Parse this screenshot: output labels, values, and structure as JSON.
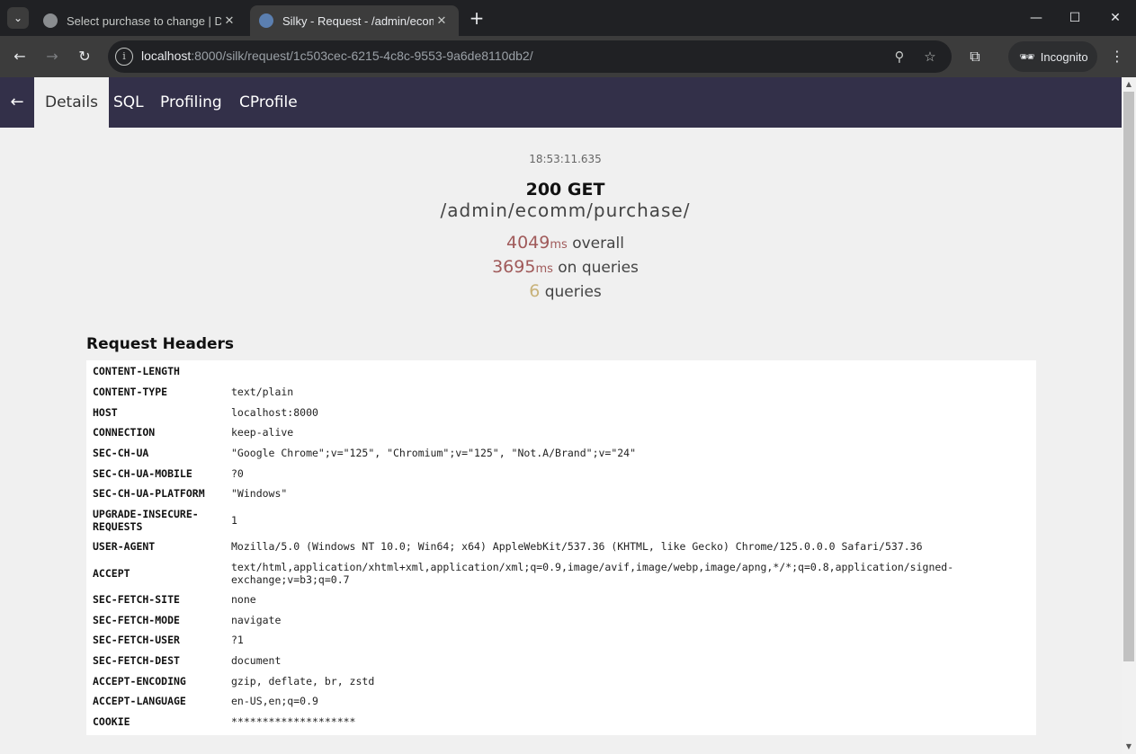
{
  "browser": {
    "tabs": [
      {
        "title": "Select purchase to change | Dja",
        "active": false
      },
      {
        "title": "Silky - Request - /admin/ecomm",
        "active": true
      }
    ],
    "url_host": "localhost",
    "url_rest": ":8000/silk/request/1c503cec-6215-4c8c-9553-9a6de8110db2/",
    "incognito_label": "Incognito"
  },
  "silk_nav": {
    "tabs": [
      {
        "label": "Details",
        "active": true
      },
      {
        "label": "SQL",
        "active": false
      },
      {
        "label": "Profiling",
        "active": false
      },
      {
        "label": "CProfile",
        "active": false
      }
    ]
  },
  "summary": {
    "time": "18:53:11.635",
    "status": "200 GET",
    "path": "/admin/ecomm/purchase/",
    "overall_ms": "4049",
    "overall_unit": "ms",
    "overall_label": "overall",
    "queries_ms": "3695",
    "queries_unit": "ms",
    "queries_ms_label": "on queries",
    "num_queries": "6",
    "num_queries_label": "queries"
  },
  "request_headers": {
    "title": "Request Headers",
    "rows": [
      {
        "key": "CONTENT-LENGTH",
        "value": ""
      },
      {
        "key": "CONTENT-TYPE",
        "value": "text/plain"
      },
      {
        "key": "HOST",
        "value": "localhost:8000"
      },
      {
        "key": "CONNECTION",
        "value": "keep-alive"
      },
      {
        "key": "SEC-CH-UA",
        "value": "\"Google Chrome\";v=\"125\", \"Chromium\";v=\"125\", \"Not.A/Brand\";v=\"24\""
      },
      {
        "key": "SEC-CH-UA-MOBILE",
        "value": "?0"
      },
      {
        "key": "SEC-CH-UA-PLATFORM",
        "value": "\"Windows\""
      },
      {
        "key": "UPGRADE-INSECURE-REQUESTS",
        "value": "1"
      },
      {
        "key": "USER-AGENT",
        "value": "Mozilla/5.0 (Windows NT 10.0; Win64; x64) AppleWebKit/537.36 (KHTML, like Gecko) Chrome/125.0.0.0 Safari/537.36"
      },
      {
        "key": "ACCEPT",
        "value": "text/html,application/xhtml+xml,application/xml;q=0.9,image/avif,image/webp,image/apng,*/*;q=0.8,application/signed-exchange;v=b3;q=0.7"
      },
      {
        "key": "SEC-FETCH-SITE",
        "value": "none"
      },
      {
        "key": "SEC-FETCH-MODE",
        "value": "navigate"
      },
      {
        "key": "SEC-FETCH-USER",
        "value": "?1"
      },
      {
        "key": "SEC-FETCH-DEST",
        "value": "document"
      },
      {
        "key": "ACCEPT-ENCODING",
        "value": "gzip, deflate, br, zstd"
      },
      {
        "key": "ACCEPT-LANGUAGE",
        "value": "en-US,en;q=0.9"
      },
      {
        "key": "COOKIE",
        "value": "********************"
      }
    ]
  }
}
